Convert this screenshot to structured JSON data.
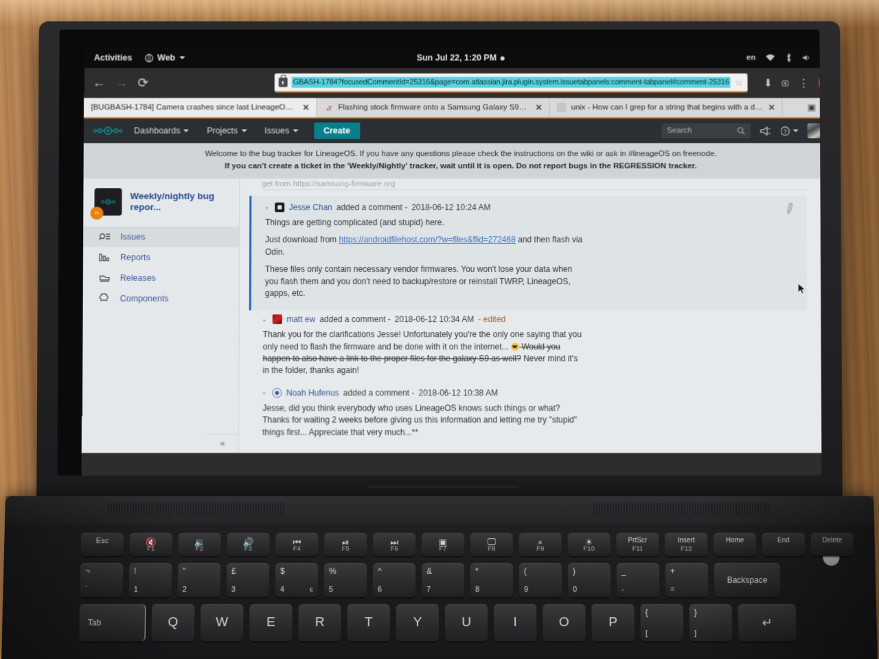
{
  "os_bar": {
    "activities": "Activities",
    "app_name": "Web",
    "clock": "Sun Jul 22,  1:20 PM",
    "language": "en",
    "icons": [
      "wifi-icon",
      "bluetooth-icon",
      "volume-icon",
      "battery-icon"
    ]
  },
  "browser": {
    "back_icon": "←",
    "forward_icon": "→",
    "reload_icon": "⟳",
    "url": "GBASH-1784?focusedCommentId=25316&page=com.atlassian.jira.plugin.system.issuetabpanels:comment-tabpanel#comment-25316",
    "star_icon": "☆",
    "download_icon": "⬇",
    "library_icon": "★",
    "menu_icon": "⋮",
    "close_icon": "✕",
    "tabs": [
      {
        "title": "[BUGBASH-1784] Camera crashes since last LineageOS u...",
        "favicon": "none",
        "active": true,
        "close": "✕"
      },
      {
        "title": "Flashing stock firmware onto a Samsung Galaxy S9+ (SM...",
        "favicon": "xda-a",
        "active": false,
        "close": "✕"
      },
      {
        "title": "unix - How can I grep for a string that begins with a das...",
        "favicon": "stackexchange",
        "active": false,
        "close": "✕"
      }
    ],
    "tablist_icon": "▣",
    "tabmenu_icon": "▾"
  },
  "jira": {
    "logo": "lineageos-logo",
    "nav": [
      {
        "label": "Dashboards",
        "has_caret": true
      },
      {
        "label": "Projects",
        "has_caret": true
      },
      {
        "label": "Issues",
        "has_caret": true
      }
    ],
    "create_label": "Create",
    "search_placeholder": "Search",
    "search_icon": "🔍",
    "announce_icon": "megaphone-icon",
    "help_icon": "?",
    "banner_line1": "Welcome to the bug tracker for LineageOS. If you have any questions please check the instructions on the wiki or ask in #lineageOS on freenode.",
    "banner_line2": "If you can't create a ticket in the 'Weekly/Nightly' tracker, wait until it is open. Do not report bugs in the REGRESSION tracker."
  },
  "sidebar": {
    "project_name": "Weekly/nightly bug repor...",
    "project_badge": "‹›",
    "items": [
      {
        "label": "Issues",
        "icon": "issues-icon",
        "active": true
      },
      {
        "label": "Reports",
        "icon": "reports-icon",
        "active": false
      },
      {
        "label": "Releases",
        "icon": "releases-icon",
        "active": false
      },
      {
        "label": "Components",
        "icon": "components-icon",
        "active": false
      }
    ],
    "collapse_icon": "«"
  },
  "content": {
    "cut_off_line": "get from https://samsung-firmware.org",
    "comments": [
      {
        "author": "Jesse Chan",
        "avatar": "av-jesse",
        "action": "added a comment -",
        "timestamp": "2018-06-12 10:24 AM",
        "edited": "",
        "focused": true,
        "attach_icon": "🖉",
        "paragraphs": [
          {
            "parts": [
              {
                "t": "Things are getting complicated (and stupid) here.",
                "k": "text"
              }
            ]
          },
          {
            "parts": [
              {
                "t": "Just download from ",
                "k": "text"
              },
              {
                "t": "https://androidfilehost.com/?w=files&flid=272468",
                "k": "link"
              },
              {
                "t": " and then flash via Odin.",
                "k": "text"
              }
            ]
          },
          {
            "parts": [
              {
                "t": "These files only contain necessary vendor firmwares. You won't lose your data when you flash them and you don't need to backup/restore or reinstall TWRP, LineageOS, gapps, etc.",
                "k": "text"
              }
            ]
          }
        ]
      },
      {
        "author": "matt ew",
        "avatar": "av-matt",
        "action": "added a comment -",
        "timestamp": "2018-06-12 10:34 AM",
        "edited": "- edited",
        "focused": false,
        "attach_icon": "",
        "paragraphs": [
          {
            "parts": [
              {
                "t": "Thank you for the clarifications Jesse! Unfortunately you're the only one saying that you only need to flash the firmware and be done with it on the internet... ",
                "k": "text"
              },
              {
                "t": "",
                "k": "emoji"
              },
              {
                "t": " Would you happen to also have a link to the proper files for the galaxy S9 as well?",
                "k": "strike"
              },
              {
                "t": " Never mind it's in the folder, thanks again!",
                "k": "text"
              }
            ]
          }
        ]
      },
      {
        "author": "Noah Hufenus",
        "avatar": "av-noah",
        "action": "added a comment -",
        "timestamp": "2018-06-12 10:38 AM",
        "edited": "",
        "focused": false,
        "attach_icon": "",
        "paragraphs": [
          {
            "parts": [
              {
                "t": "Jesse, did you think everybody who uses LineageOS knows such things or what? Thanks for waiting 2 weeks before giving us this information and letting me try \"stupid\" things first... Appreciate that very much...**",
                "k": "text"
              }
            ]
          }
        ]
      }
    ]
  },
  "keyboard": {
    "row_fn": [
      {
        "main": "Esc",
        "sub": "",
        "fn": ""
      },
      {
        "main": "🔇",
        "sub": "",
        "fn": "F1"
      },
      {
        "main": "🔉",
        "sub": "",
        "fn": "F2"
      },
      {
        "main": "🔊",
        "sub": "",
        "fn": "F3"
      },
      {
        "main": "⏮",
        "sub": "",
        "fn": "F4"
      },
      {
        "main": "⏯",
        "sub": "",
        "fn": "F5"
      },
      {
        "main": "⏭",
        "sub": "",
        "fn": "F6"
      },
      {
        "main": "▣",
        "sub": "",
        "fn": "F7"
      },
      {
        "main": "🖵",
        "sub": "",
        "fn": "F8"
      },
      {
        "main": "⌕",
        "sub": "",
        "fn": "F9"
      },
      {
        "main": "☀",
        "sub": "",
        "fn": "F10"
      },
      {
        "main": "PrtScr",
        "sub": "",
        "fn": "F11"
      },
      {
        "main": "Insert",
        "sub": "",
        "fn": "F12"
      },
      {
        "main": "Home",
        "sub": "",
        "fn": ""
      },
      {
        "main": "End",
        "sub": "",
        "fn": ""
      },
      {
        "main": "Delete",
        "sub": "",
        "fn": ""
      }
    ],
    "row_num": [
      {
        "top": "¬",
        "bottom": "`",
        "alt": ""
      },
      {
        "top": "!",
        "bottom": "1",
        "alt": ""
      },
      {
        "top": "\"",
        "bottom": "2",
        "alt": ""
      },
      {
        "top": "£",
        "bottom": "3",
        "alt": ""
      },
      {
        "top": "$",
        "bottom": "4",
        "alt": "€"
      },
      {
        "top": "%",
        "bottom": "5",
        "alt": ""
      },
      {
        "top": "^",
        "bottom": "6",
        "alt": ""
      },
      {
        "top": "&",
        "bottom": "7",
        "alt": ""
      },
      {
        "top": "*",
        "bottom": "8",
        "alt": ""
      },
      {
        "top": "(",
        "bottom": "9",
        "alt": ""
      },
      {
        "top": ")",
        "bottom": "0",
        "alt": ""
      },
      {
        "top": "_",
        "bottom": "-",
        "alt": ""
      },
      {
        "top": "+",
        "bottom": "=",
        "alt": ""
      },
      {
        "top": "",
        "bottom": "Backspace",
        "alt": ""
      }
    ],
    "row_qwerty": [
      {
        "label": "Tab"
      },
      {
        "label": "Q"
      },
      {
        "label": "W"
      },
      {
        "label": "E"
      },
      {
        "label": "R"
      },
      {
        "label": "T"
      },
      {
        "label": "Y"
      },
      {
        "label": "U"
      },
      {
        "label": "I"
      },
      {
        "label": "O"
      },
      {
        "label": "P"
      },
      {
        "label": "{"
      },
      {
        "label": "}"
      },
      {
        "label": "↵"
      }
    ]
  },
  "colors": {
    "jira_nav": "#2b2f33",
    "create_teal": "#0a7f8c",
    "link_blue": "#3b5998",
    "focus_blue": "#2a62c4",
    "badge_orange": "#e8820c",
    "firefox_orange": "#e07b20",
    "url_highlight": "#57d4dd"
  }
}
